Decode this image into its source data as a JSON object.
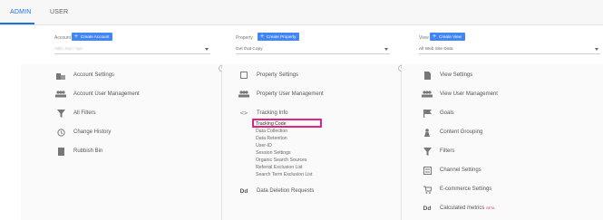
{
  "tabs": [
    {
      "label": "ADMIN",
      "active": true
    },
    {
      "label": "USER",
      "active": false
    }
  ],
  "account": {
    "heading": "Account",
    "create_label": "Create Account",
    "selected": "ABC-Xxx / xyz"
  },
  "property": {
    "heading": "Property",
    "create_label": "Create Property",
    "selected": "Get that Copy",
    "items": [
      {
        "label": "Property Settings",
        "icon": "box-icon"
      },
      {
        "label": "Property User Management",
        "icon": "users-icon"
      },
      {
        "label": "Tracking Info",
        "icon": "code-icon"
      },
      {
        "label": "Data Deletion Requests",
        "icon": "dd-icon"
      }
    ],
    "tracking_sub": [
      "Tracking Code",
      "Data Collection",
      "Data Retention",
      "User-ID",
      "Session Settings",
      "Organic Search Sources",
      "Referral Exclusion List",
      "Search Term Exclusion List"
    ]
  },
  "account_items": [
    {
      "label": "Account Settings",
      "icon": "building-icon"
    },
    {
      "label": "Account User Management",
      "icon": "users-icon"
    },
    {
      "label": "All Filters",
      "icon": "filter-icon"
    },
    {
      "label": "Change History",
      "icon": "history-icon"
    },
    {
      "label": "Rubbish Bin",
      "icon": "trash-icon"
    }
  ],
  "view": {
    "heading": "View",
    "create_label": "Create View",
    "selected": "All Web Site Data",
    "items": [
      {
        "label": "View Settings",
        "icon": "document-icon"
      },
      {
        "label": "View User Management",
        "icon": "users-icon"
      },
      {
        "label": "Goals",
        "icon": "flag-icon"
      },
      {
        "label": "Content Grouping",
        "icon": "person-icon"
      },
      {
        "label": "Filters",
        "icon": "filter-icon"
      },
      {
        "label": "Channel Settings",
        "icon": "channel-icon"
      },
      {
        "label": "E-commerce Settings",
        "icon": "cart-icon"
      },
      {
        "label": "Calculated metrics",
        "icon": "dd-icon",
        "badge": "BETA"
      }
    ]
  },
  "colors": {
    "accent": "#1a73e8",
    "button": "#4285f4",
    "highlight": "#e7227b"
  }
}
